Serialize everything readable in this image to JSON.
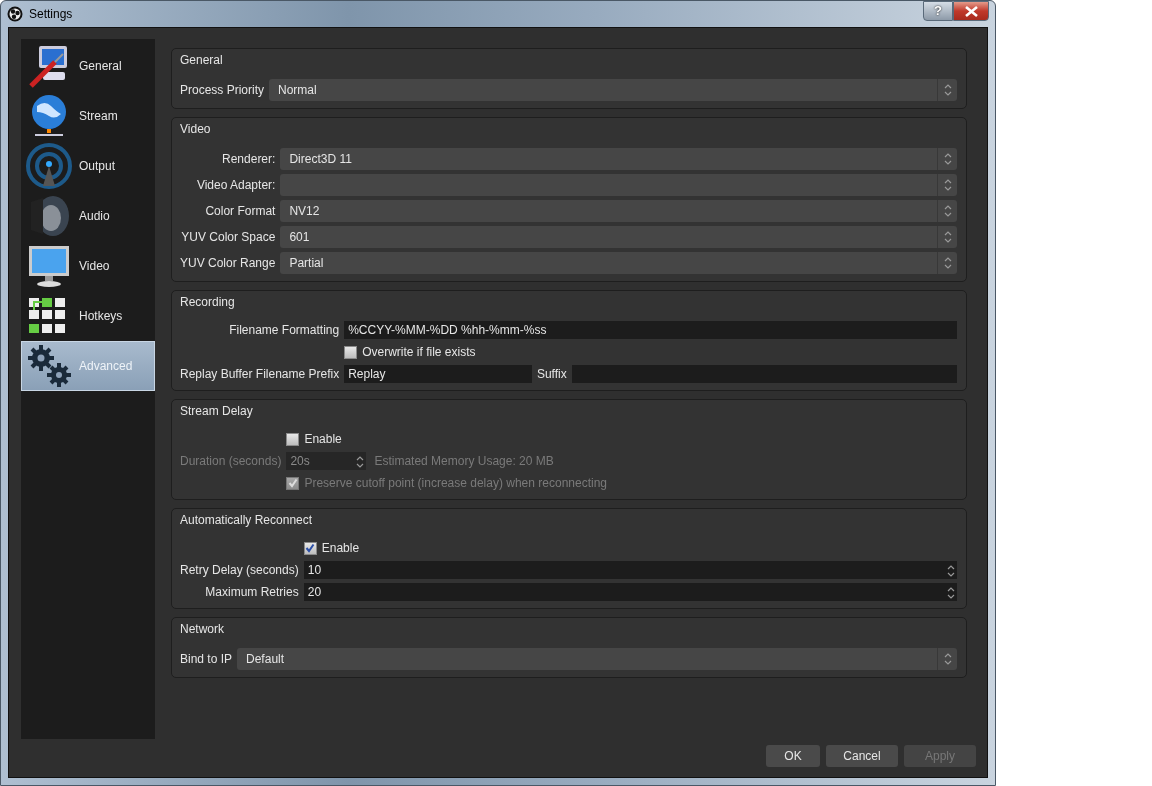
{
  "window": {
    "title": "Settings",
    "help_button": "?"
  },
  "sidebar": {
    "items": [
      {
        "label": "General",
        "selected": false
      },
      {
        "label": "Stream",
        "selected": false
      },
      {
        "label": "Output",
        "selected": false
      },
      {
        "label": "Audio",
        "selected": false
      },
      {
        "label": "Video",
        "selected": false
      },
      {
        "label": "Hotkeys",
        "selected": false
      },
      {
        "label": "Advanced",
        "selected": true
      }
    ]
  },
  "sections": [
    {
      "title": "General",
      "rows": [
        {
          "kind": "select",
          "label": "Process Priority",
          "value": "Normal"
        }
      ]
    },
    {
      "title": "Video",
      "rows": [
        {
          "kind": "select",
          "label": "Renderer:",
          "value": "Direct3D 11"
        },
        {
          "kind": "select",
          "label": "Video Adapter:"
        },
        {
          "kind": "select",
          "label": "Color Format",
          "value": "NV12"
        },
        {
          "kind": "select",
          "label": "YUV Color Space",
          "value": "601"
        },
        {
          "kind": "select",
          "label": "YUV Color Range",
          "value": "Partial"
        }
      ]
    },
    {
      "title": "Recording",
      "rows": [
        {
          "kind": "text",
          "label": "Filename Formatting",
          "value": "%CCYY-%MM-%DD %hh-%mm-%ss"
        },
        {
          "kind": "checkbox",
          "label": "Overwrite if file exists",
          "checked": false,
          "disabled": false
        },
        {
          "kind": "pair",
          "label": "Replay Buffer Filename Prefix",
          "value": "Replay",
          "label2": "Suffix"
        }
      ]
    },
    {
      "title": "Stream Delay",
      "rows": [
        {
          "kind": "checkbox",
          "label": "Enable",
          "checked": false,
          "disabled": false
        },
        {
          "kind": "duration",
          "label": "Duration (seconds)",
          "value": "20s",
          "note": "Estimated Memory Usage: 20 MB",
          "disabled": true
        },
        {
          "kind": "checkbox",
          "label": "Preserve cutoff point (increase delay) when reconnecting",
          "checked": true,
          "disabled": true
        }
      ]
    },
    {
      "title": "Automatically Reconnect",
      "rows": [
        {
          "kind": "checkbox",
          "label": "Enable",
          "checked": true,
          "disabled": false
        },
        {
          "kind": "spin",
          "label": "Retry Delay (seconds)",
          "value": "10"
        },
        {
          "kind": "spin",
          "label": "Maximum Retries",
          "value": "20"
        }
      ]
    },
    {
      "title": "Network",
      "rows": [
        {
          "kind": "select",
          "label": "Bind to IP",
          "value": "Default"
        }
      ]
    }
  ],
  "buttons": [
    {
      "label": "OK",
      "disabled": false
    },
    {
      "label": "Cancel",
      "disabled": false
    },
    {
      "label": "Apply",
      "disabled": true
    }
  ]
}
